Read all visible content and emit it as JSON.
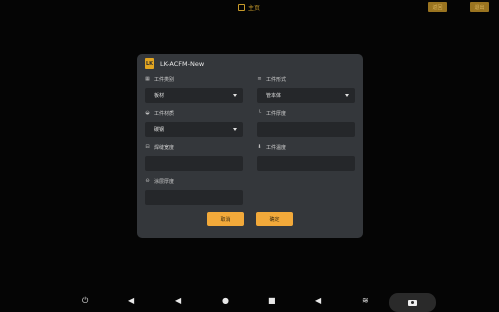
{
  "topbar": {
    "title": "主页",
    "btn_left": "返回",
    "btn_right": "退出"
  },
  "dialog": {
    "title": "LK-ACFM-New",
    "logo_text": "LK",
    "fields": {
      "workpiece_type": {
        "label": "工件类别",
        "value": "板材",
        "icon": "grid-icon"
      },
      "workpiece_form": {
        "label": "工件形式",
        "value": "管本体",
        "icon": "sliders-icon"
      },
      "workpiece_material": {
        "label": "工件材质",
        "value": "碳钢",
        "icon": "wifi-icon"
      },
      "workpiece_thickness": {
        "label": "工件厚度",
        "value": "",
        "icon": "ruler-icon"
      },
      "weld_width": {
        "label": "焊缝宽度",
        "value": "",
        "icon": "weld-icon"
      },
      "workpiece_temperature": {
        "label": "工件温度",
        "value": "",
        "icon": "thermometer-icon"
      },
      "coating_thickness": {
        "label": "涂层厚度",
        "value": "",
        "icon": "coating-icon"
      }
    },
    "cancel_label": "取消",
    "confirm_label": "确定"
  },
  "colors": {
    "accent": "#f2a93a",
    "dialog_bg": "#34373b",
    "field_bg": "#25272a",
    "screen_bg": "#050505"
  },
  "navbar": {
    "icons": [
      "power-icon",
      "volume-down-icon",
      "back-icon",
      "home-icon",
      "recents-icon",
      "volume-up-icon",
      "expand-icon",
      "camera-icon"
    ]
  }
}
